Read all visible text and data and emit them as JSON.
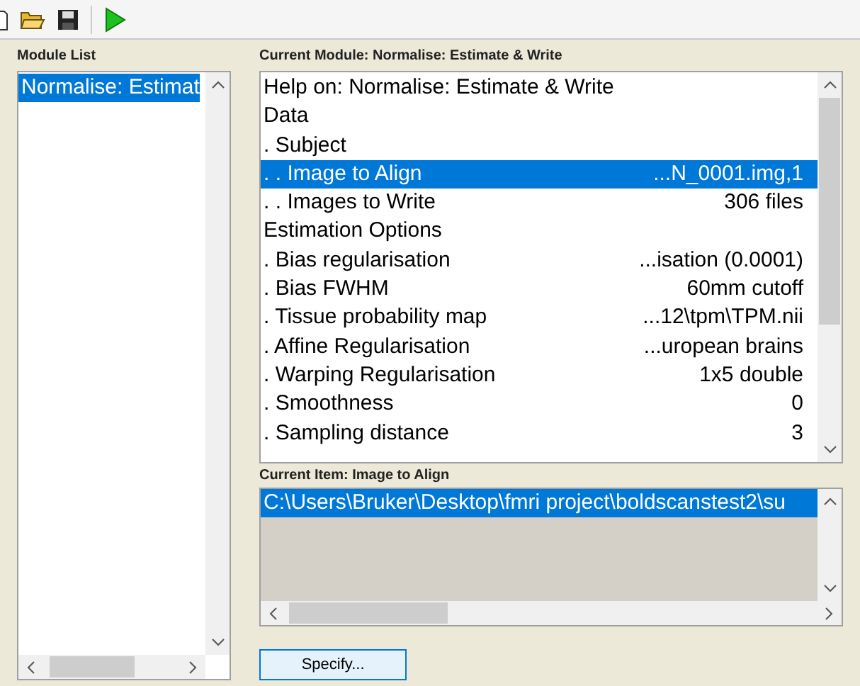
{
  "toolbar": [
    {
      "kind": "new"
    },
    {
      "kind": "open"
    },
    {
      "kind": "save"
    },
    {
      "kind": "run"
    }
  ],
  "module_list": {
    "label": "Module List",
    "items": [
      {
        "label": "Normalise: Estimat",
        "selected": true
      }
    ]
  },
  "current_module": {
    "label": "Current Module: Normalise: Estimate & Write",
    "rows": [
      {
        "label": "Help on: Normalise: Estimate & Write",
        "selected": false
      },
      {
        "label": "Data",
        "selected": false
      },
      {
        "label": ". Subject",
        "selected": false
      },
      {
        "label": ". . Image to Align",
        "value": "...N_0001.img,1",
        "selected": true
      },
      {
        "label": ". . Images to Write",
        "value": "306 files",
        "selected": false
      },
      {
        "label": "Estimation Options",
        "selected": false
      },
      {
        "label": ". Bias regularisation",
        "value": "...isation (0.0001)",
        "selected": false
      },
      {
        "label": ". Bias FWHM",
        "value": "60mm cutoff",
        "selected": false
      },
      {
        "label": ". Tissue probability map",
        "value": "...12\\tpm\\TPM.nii",
        "selected": false
      },
      {
        "label": ". Affine Regularisation",
        "value": "...uropean brains",
        "selected": false
      },
      {
        "label": ". Warping Regularisation",
        "value": "1x5 double",
        "selected": false
      },
      {
        "label": ". Smoothness",
        "value": "0",
        "selected": false
      },
      {
        "label": ". Sampling distance",
        "value": "3",
        "selected": false
      }
    ]
  },
  "current_item": {
    "label": "Current Item: Image to Align",
    "items": [
      {
        "label": "C:\\Users\\Bruker\\Desktop\\fmri project\\boldscanstest2\\su",
        "selected": true
      }
    ]
  },
  "button": "Specify..."
}
